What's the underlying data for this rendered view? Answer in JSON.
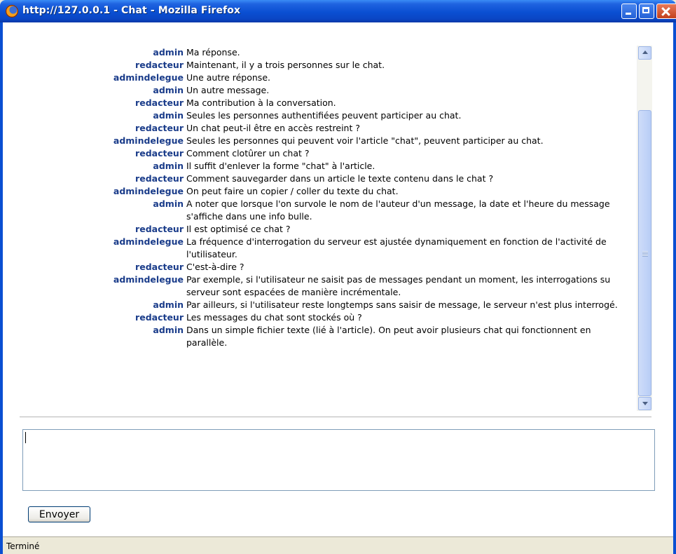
{
  "window": {
    "title": "http://127.0.0.1 - Chat - Mozilla Firefox"
  },
  "messages": [
    {
      "author": "admin",
      "text": "Ma réponse."
    },
    {
      "author": "redacteur",
      "text": "Maintenant, il y a trois personnes sur le chat."
    },
    {
      "author": "admindelegue",
      "text": "Une autre réponse."
    },
    {
      "author": "admin",
      "text": "Un autre message."
    },
    {
      "author": "redacteur",
      "text": "Ma contribution à la conversation."
    },
    {
      "author": "admin",
      "text": "Seules les personnes authentifiées peuvent participer au chat."
    },
    {
      "author": "redacteur",
      "text": "Un chat peut-il être en accès restreint ?"
    },
    {
      "author": "admindelegue",
      "text": "Seules les personnes qui peuvent voir l'article \"chat\", peuvent participer au chat."
    },
    {
      "author": "redacteur",
      "text": "Comment clotûrer un chat ?"
    },
    {
      "author": "admin",
      "text": "Il suffit d'enlever la forme \"chat\" à l'article."
    },
    {
      "author": "redacteur",
      "text": "Comment sauvegarder dans un article le texte contenu dans le chat ?"
    },
    {
      "author": "admindelegue",
      "text": "On peut faire un copier / coller du texte du chat."
    },
    {
      "author": "admin",
      "text": "A noter que lorsque l'on survole le nom de l'auteur d'un message, la date et l'heure du message s'affiche dans une info bulle."
    },
    {
      "author": "redacteur",
      "text": "Il est optimisé ce chat ?"
    },
    {
      "author": "admindelegue",
      "text": "La fréquence d'interrogation du serveur est ajustée dynamiquement en fonction de l'activité de l'utilisateur."
    },
    {
      "author": "redacteur",
      "text": "C'est-à-dire ?"
    },
    {
      "author": "admindelegue",
      "text": "Par exemple, si l'utilisateur ne saisit pas de messages pendant un moment, les interrogations su serveur sont espacées de manière incrémentale."
    },
    {
      "author": "admin",
      "text": "Par ailleurs, si l'utilisateur reste longtemps sans saisir de message, le serveur n'est plus interrogé."
    },
    {
      "author": "redacteur",
      "text": "Les messages du chat sont stockés où ?"
    },
    {
      "author": "admin",
      "text": "Dans un simple fichier texte (lié à l'article). On peut avoir plusieurs chat qui fonctionnent en parallèle."
    }
  ],
  "input": {
    "value": "",
    "placeholder": ""
  },
  "send_button": {
    "label": "Envoyer"
  },
  "statusbar": {
    "text": "Terminé"
  },
  "colors": {
    "author": "#1a3c8a",
    "titlebar": "#0a4fd2"
  }
}
